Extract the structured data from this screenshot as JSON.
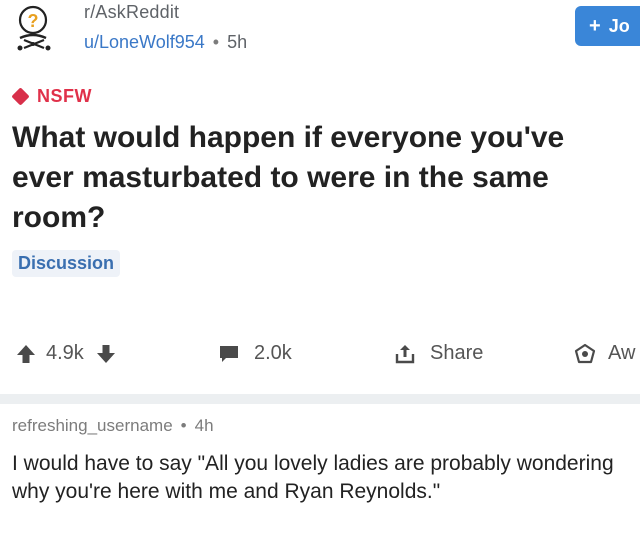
{
  "header": {
    "subreddit": "r/AskReddit",
    "author": "u/LoneWolf954",
    "separator": "•",
    "time": "5h",
    "join_label": "Jo",
    "join_icon": "plus-icon"
  },
  "post": {
    "nsfw_label": "NSFW",
    "title": "What would happen if everyone you've ever masturbated to were in the same room?",
    "flair": "Discussion"
  },
  "actions": {
    "upvotes": "4.9k",
    "comments": "2.0k",
    "share_label": "Share",
    "award_label": "Aw"
  },
  "comment": {
    "username": "refreshing_username",
    "separator": "•",
    "time": "4h",
    "body": "I would have to say \"All you lovely ladies are probably wondering why you're here with me and Ryan Reynolds.\""
  },
  "colors": {
    "nsfw": "#e0314a",
    "join_button": "#3a86d8",
    "author": "#3a78c7",
    "flair_text": "#3a6fb0",
    "flair_bg": "#eef2f8",
    "divider": "#eceff1"
  }
}
